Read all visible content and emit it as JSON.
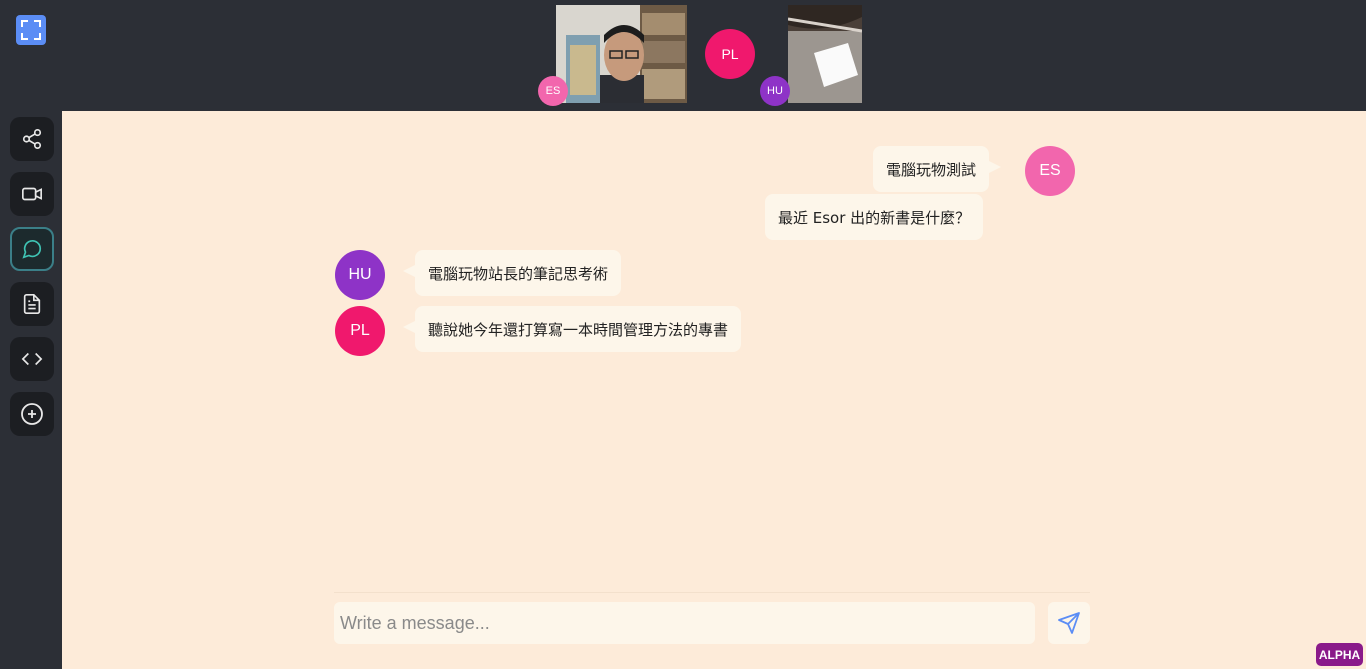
{
  "top_bar": {
    "fullscreen_icon": "fullscreen-icon",
    "participants": [
      {
        "initials": "ES",
        "color": "#f266ad"
      },
      {
        "initials": "PL",
        "color": "#f0186d"
      },
      {
        "initials": "HU",
        "color": "#8e33c7"
      }
    ]
  },
  "sidebar": {
    "items": [
      {
        "name": "share",
        "icon": "share-icon"
      },
      {
        "name": "video",
        "icon": "video-icon"
      },
      {
        "name": "chat",
        "icon": "chat-icon",
        "active": true
      },
      {
        "name": "document",
        "icon": "document-icon"
      },
      {
        "name": "code",
        "icon": "code-icon"
      },
      {
        "name": "add",
        "icon": "plus-circle-icon"
      }
    ]
  },
  "chat": {
    "messages": [
      {
        "sender": "ES",
        "text": "電腦玩物測試",
        "side": "right"
      },
      {
        "sender": "ES",
        "text": "最近 Esor 出的新書是什麼？",
        "side": "right"
      },
      {
        "sender": "HU",
        "text": "電腦玩物站長的筆記思考術",
        "side": "left"
      },
      {
        "sender": "PL",
        "text": "聽說她今年還打算寫一本時間管理方法的專書",
        "side": "left"
      }
    ],
    "input": {
      "placeholder": "Write a message...",
      "value": ""
    },
    "send_icon": "send-icon"
  },
  "badge": {
    "label": "ALPHA"
  },
  "colors": {
    "background": "#2c2f36",
    "chat_panel": "#fdebd9",
    "bubble": "#fdf6ea",
    "accent": "#5b8df5"
  }
}
